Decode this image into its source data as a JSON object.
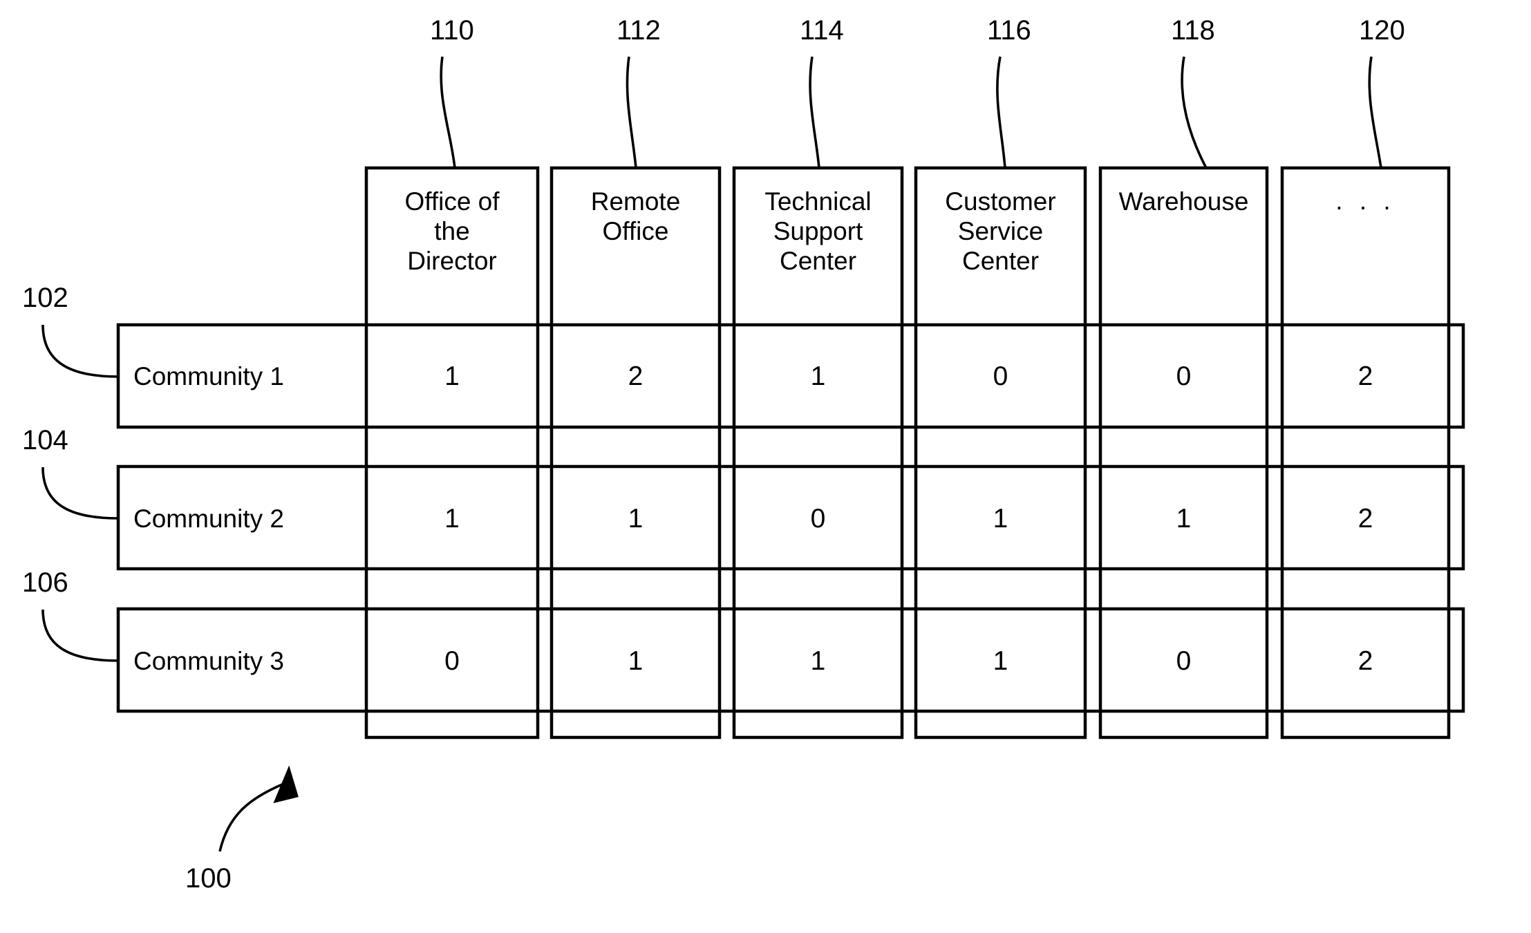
{
  "figure": {
    "figure_ref": "100",
    "column_refs": [
      "110",
      "112",
      "114",
      "116",
      "118",
      "120"
    ],
    "row_refs": [
      "102",
      "104",
      "106"
    ],
    "columns": [
      {
        "label": "Office of\nthe\nDirector",
        "ref": "110"
      },
      {
        "label": "Remote\nOffice",
        "ref": "112"
      },
      {
        "label": "Technical\nSupport\nCenter",
        "ref": "114"
      },
      {
        "label": "Customer\nService\nCenter",
        "ref": "116"
      },
      {
        "label": "Warehouse",
        "ref": "118"
      },
      {
        "label": ". . .",
        "ref": "120"
      }
    ],
    "rows": [
      {
        "label": "Community 1",
        "ref": "102",
        "values": [
          "1",
          "2",
          "1",
          "0",
          "0",
          "2"
        ]
      },
      {
        "label": "Community 2",
        "ref": "104",
        "values": [
          "1",
          "1",
          "0",
          "1",
          "1",
          "2"
        ]
      },
      {
        "label": "Community 3",
        "ref": "106",
        "values": [
          "0",
          "1",
          "1",
          "1",
          "0",
          "2"
        ]
      }
    ],
    "colors": {
      "ink": "#000000",
      "paper": "#ffffff"
    }
  }
}
